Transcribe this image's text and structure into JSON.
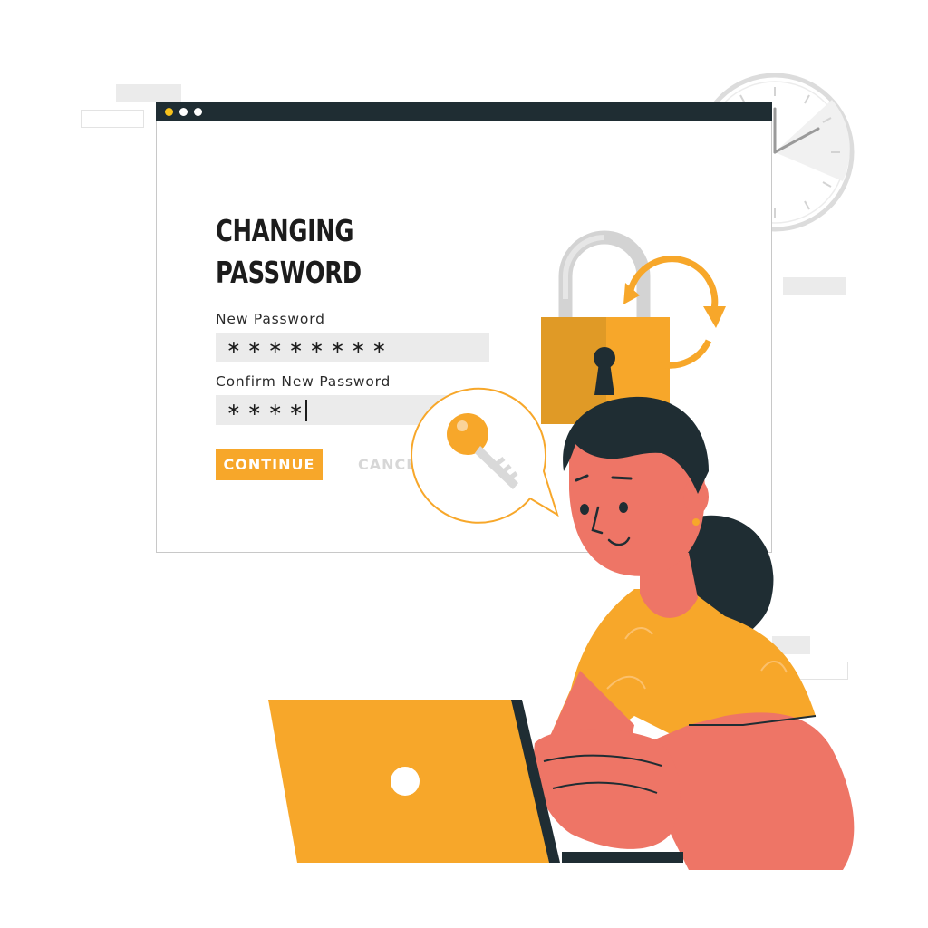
{
  "form": {
    "title_line1": "CHANGING",
    "title_line2": "PASSWORD",
    "new_password_label": "New Password",
    "new_password_value": "∗∗∗∗∗∗∗∗",
    "confirm_label": "Confirm New Password",
    "confirm_value": "∗∗∗∗",
    "continue_label": "CONTINUE",
    "cancel_label": "CANCEL"
  },
  "colors": {
    "accent": "#f7a72a",
    "titlebar": "#1f2d33",
    "skin": "#ee7566",
    "hair": "#1f2d33"
  },
  "icons": [
    "padlock-icon",
    "refresh-arrow-icon",
    "key-icon",
    "clock-icon"
  ]
}
